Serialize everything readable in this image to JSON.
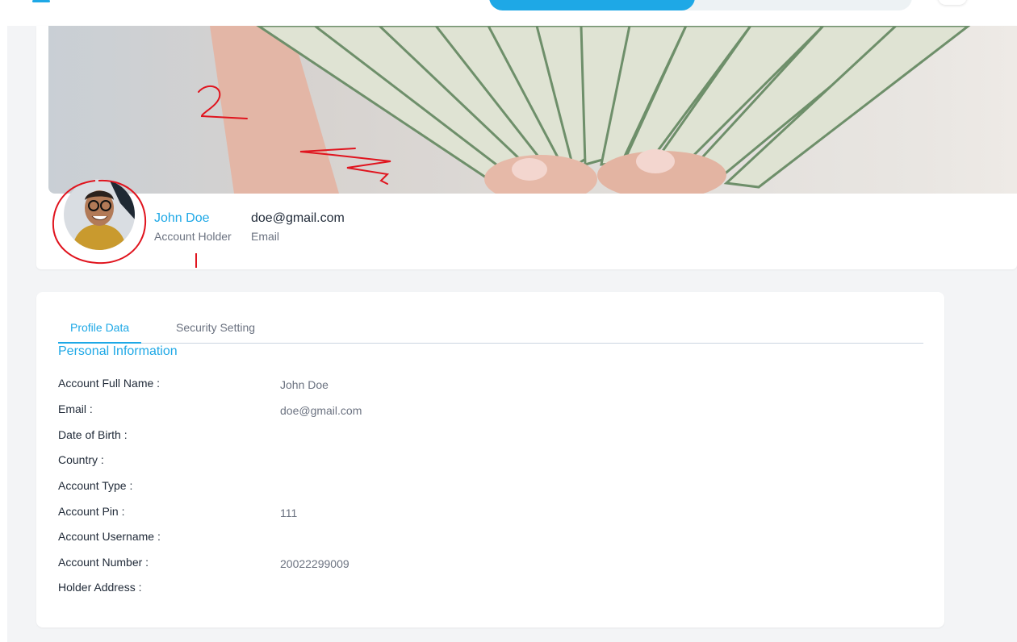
{
  "profile": {
    "name": "John Doe",
    "role": "Account Holder",
    "email": "doe@gmail.com",
    "email_caption": "Email"
  },
  "tabs": [
    {
      "label": "Profile Data",
      "active": true
    },
    {
      "label": "Security Setting",
      "active": false
    }
  ],
  "section_title": "Personal Information",
  "fields": [
    {
      "label": "Account Full Name :",
      "value": "John Doe"
    },
    {
      "label": "Email :",
      "value": "doe@gmail.com"
    },
    {
      "label": "Date of Birth :",
      "value": ""
    },
    {
      "label": "Country :",
      "value": ""
    },
    {
      "label": "Account Type :",
      "value": ""
    },
    {
      "label": "Account Pin :",
      "value": "111"
    },
    {
      "label": "Account Username :",
      "value": ""
    },
    {
      "label": "Account Number :",
      "value": "20022299009"
    },
    {
      "label": "Holder Address :",
      "value": ""
    }
  ],
  "annotations": [
    "2",
    "3",
    "1"
  ],
  "colors": {
    "accent": "#1ea8e6",
    "annotation": "#e0141e",
    "banknote_green": "#6e8f6a"
  },
  "icons": {
    "menu": "hamburger-icon",
    "top_right": "notification-icon"
  }
}
